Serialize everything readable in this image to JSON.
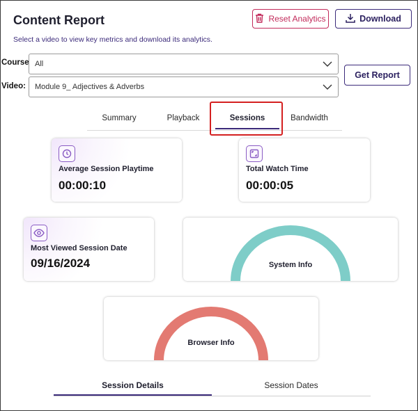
{
  "header": {
    "title": "Content Report",
    "subtitle": "Select a video to view key metrics and download its analytics.",
    "reset_label": "Reset Analytics",
    "download_label": "Download"
  },
  "filters": {
    "course_label": "Course:",
    "course_value": "All",
    "video_label": "Video:",
    "video_value": "Module 9_ Adjectives & Adverbs",
    "get_report_label": "Get Report"
  },
  "tabs": [
    {
      "label": "Summary",
      "active": false
    },
    {
      "label": "Playback",
      "active": false
    },
    {
      "label": "Sessions",
      "active": true
    },
    {
      "label": "Bandwidth",
      "active": false
    }
  ],
  "metrics": {
    "avg_playtime": {
      "label": "Average Session Playtime",
      "value": "00:00:10",
      "icon": "clock-icon"
    },
    "total_watch": {
      "label": "Total Watch Time",
      "value": "00:00:05",
      "icon": "expand-icon"
    },
    "most_viewed": {
      "label": "Most Viewed Session Date",
      "value": "09/16/2024",
      "icon": "eye-icon"
    }
  },
  "gauges": {
    "system": {
      "label": "System Info",
      "color": "#7ecdc8"
    },
    "browser": {
      "label": "Browser Info",
      "color": "#e37a72"
    }
  },
  "bottom_tabs": [
    {
      "label": "Session Details",
      "active": true
    },
    {
      "label": "Session Dates",
      "active": false
    }
  ],
  "colors": {
    "accent": "#3b2a7a",
    "danger": "#c22a5a",
    "highlight": "#d42020"
  }
}
